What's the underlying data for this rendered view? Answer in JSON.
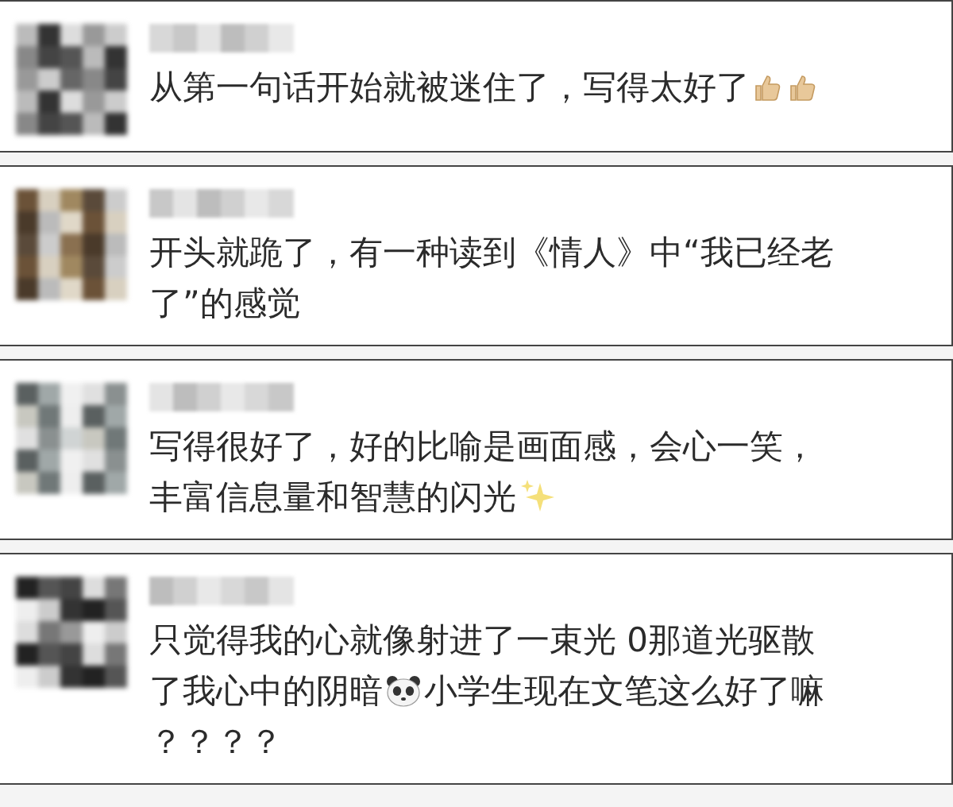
{
  "comments": [
    {
      "lines": [
        [
          {
            "kind": "text",
            "text": "从第一句话开始就被迷住了，写得太好了"
          },
          {
            "kind": "thumbs"
          },
          {
            "kind": "thumbs"
          }
        ]
      ]
    },
    {
      "lines": [
        [
          {
            "kind": "text",
            "text": "开头就跪了，有一种读到《情人》中“我已经老"
          }
        ],
        [
          {
            "kind": "text",
            "text": "了”的感觉"
          }
        ]
      ]
    },
    {
      "lines": [
        [
          {
            "kind": "text",
            "text": "写得很好了，好的比喻是画面感，会心一笑，"
          }
        ],
        [
          {
            "kind": "text",
            "text": "丰富信息量和智慧的闪光"
          },
          {
            "kind": "sparkle"
          }
        ]
      ]
    },
    {
      "lines": [
        [
          {
            "kind": "text",
            "text": "只觉得我的心就像射进了一束光 0那道光驱散"
          }
        ],
        [
          {
            "kind": "text",
            "text": "了我心中的阴暗"
          },
          {
            "kind": "panda"
          },
          {
            "kind": "text",
            "text": "小学生现在文笔这么好了嘛"
          }
        ],
        [
          {
            "kind": "text",
            "text": "？？？？"
          }
        ]
      ]
    }
  ]
}
